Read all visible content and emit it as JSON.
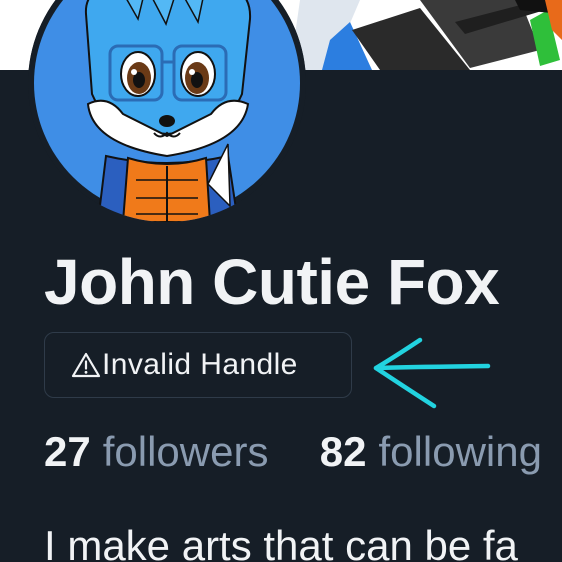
{
  "profile": {
    "display_name": "John Cutie Fox",
    "handle_status": "Invalid Handle",
    "handle_icon": "warning-triangle-icon",
    "followers_count": "27",
    "followers_label": "followers",
    "following_count": "82",
    "following_label": "following",
    "bio": "I make arts that can be fa"
  },
  "colors": {
    "background": "#161e27",
    "text_primary": "#f1f3f5",
    "text_secondary": "#8a9bb0",
    "badge_border": "#2f3b49",
    "arrow_annotation": "#22d3e0",
    "avatar_fur": "#3fa8ef",
    "avatar_background": "#3f8ee6"
  },
  "icons": {
    "avatar": "fox-character-avatar",
    "annotation": "left-arrow-icon"
  }
}
